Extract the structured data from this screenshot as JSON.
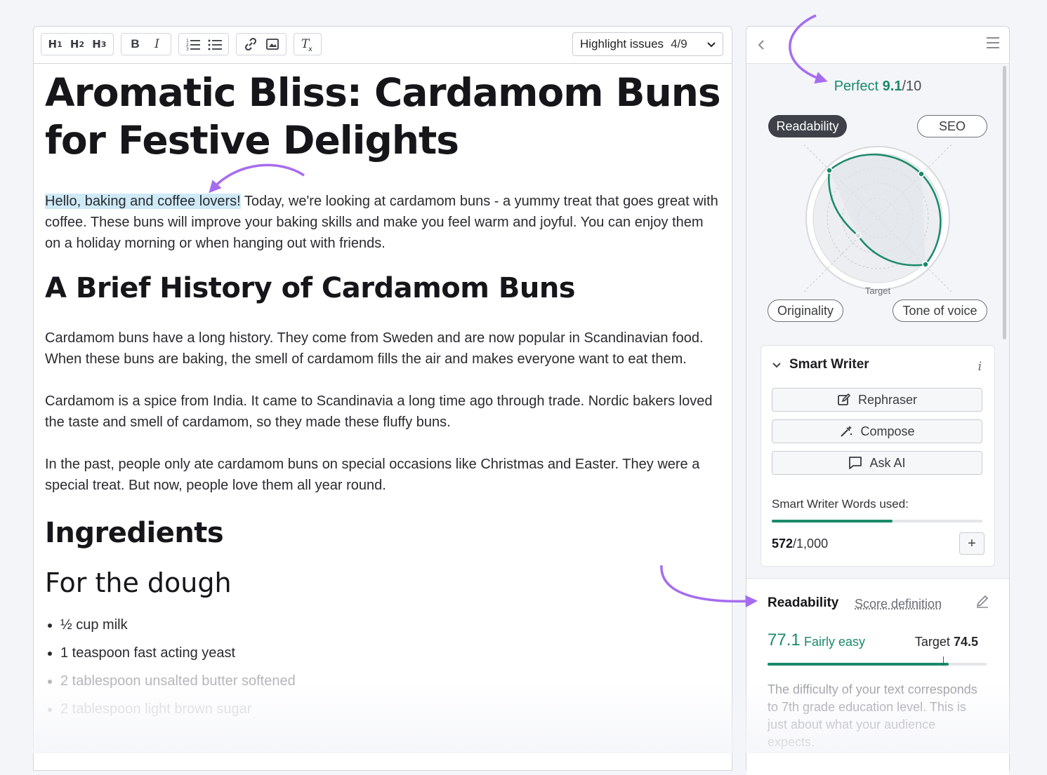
{
  "toolbar": {
    "h1": "H1",
    "h2": "H2",
    "h3": "H3",
    "bold": "B",
    "italic": "I",
    "highlight_label": "Highlight issues",
    "highlight_count": "4/9"
  },
  "article": {
    "title": "Aromatic Bliss: Cardamom Buns for Festive Delights",
    "intro_highlight": "Hello, baking and coffee lovers!",
    "intro_rest": " Today, we're looking at cardamom buns - a yummy treat that goes great with coffee. These buns will improve your baking skills and make you feel warm and joyful. You can enjoy them on a holiday morning or when hanging out with friends.",
    "section1_title": "A Brief History of Cardamom Buns",
    "section1_p1": "Cardamom buns have a long history. They come from Sweden and are now popular in Scandinavian food. When these buns are baking, the smell of cardamom fills the air and makes everyone want to eat them.",
    "section1_p2": "Cardamom is a spice from India. It came to Scandinavia a long time ago through trade. Nordic bakers loved the taste and smell of cardamom, so they made these fluffy buns.",
    "section1_p3": "In the past, people only ate cardamom buns on special occasions like Christmas and Easter. They were a special treat. But now, people love them all year round.",
    "section2_title": "Ingredients",
    "section2_sub": "For the dough",
    "ingredients": [
      "½ cup milk",
      "1 teaspoon fast acting yeast",
      "2 tablespoon unsalted butter softened",
      "2 tablespoon light brown sugar"
    ]
  },
  "panel": {
    "score_word": "Perfect",
    "score_value": "9.1",
    "score_max": "/10",
    "tab_readability": "Readability",
    "tab_seo": "SEO",
    "tab_originality": "Originality",
    "tab_tone": "Tone of voice",
    "radar_target_label": "Target",
    "smart_writer": {
      "title": "Smart Writer",
      "info": "i",
      "rephraser": "Rephraser",
      "compose": "Compose",
      "ask_ai": "Ask AI",
      "words_label": "Smart Writer Words used:",
      "words_used": "572",
      "words_total": "/1,000",
      "words_fraction": 0.572,
      "plus": "+"
    },
    "readability": {
      "title": "Readability",
      "score_definition": "Score definition",
      "score": "77.1",
      "level": "Fairly easy",
      "target_label": "Target",
      "target_value": "74.5",
      "score_fraction": 0.828,
      "target_fraction": 0.801,
      "description": "The difficulty of your text corresponds to 7th grade education level. This is just about what your audience expects."
    }
  },
  "colors": {
    "accent_green": "#1a8a6a",
    "annotation_purple": "#a66cf0",
    "highlight_blue": "#cfeaf7"
  }
}
